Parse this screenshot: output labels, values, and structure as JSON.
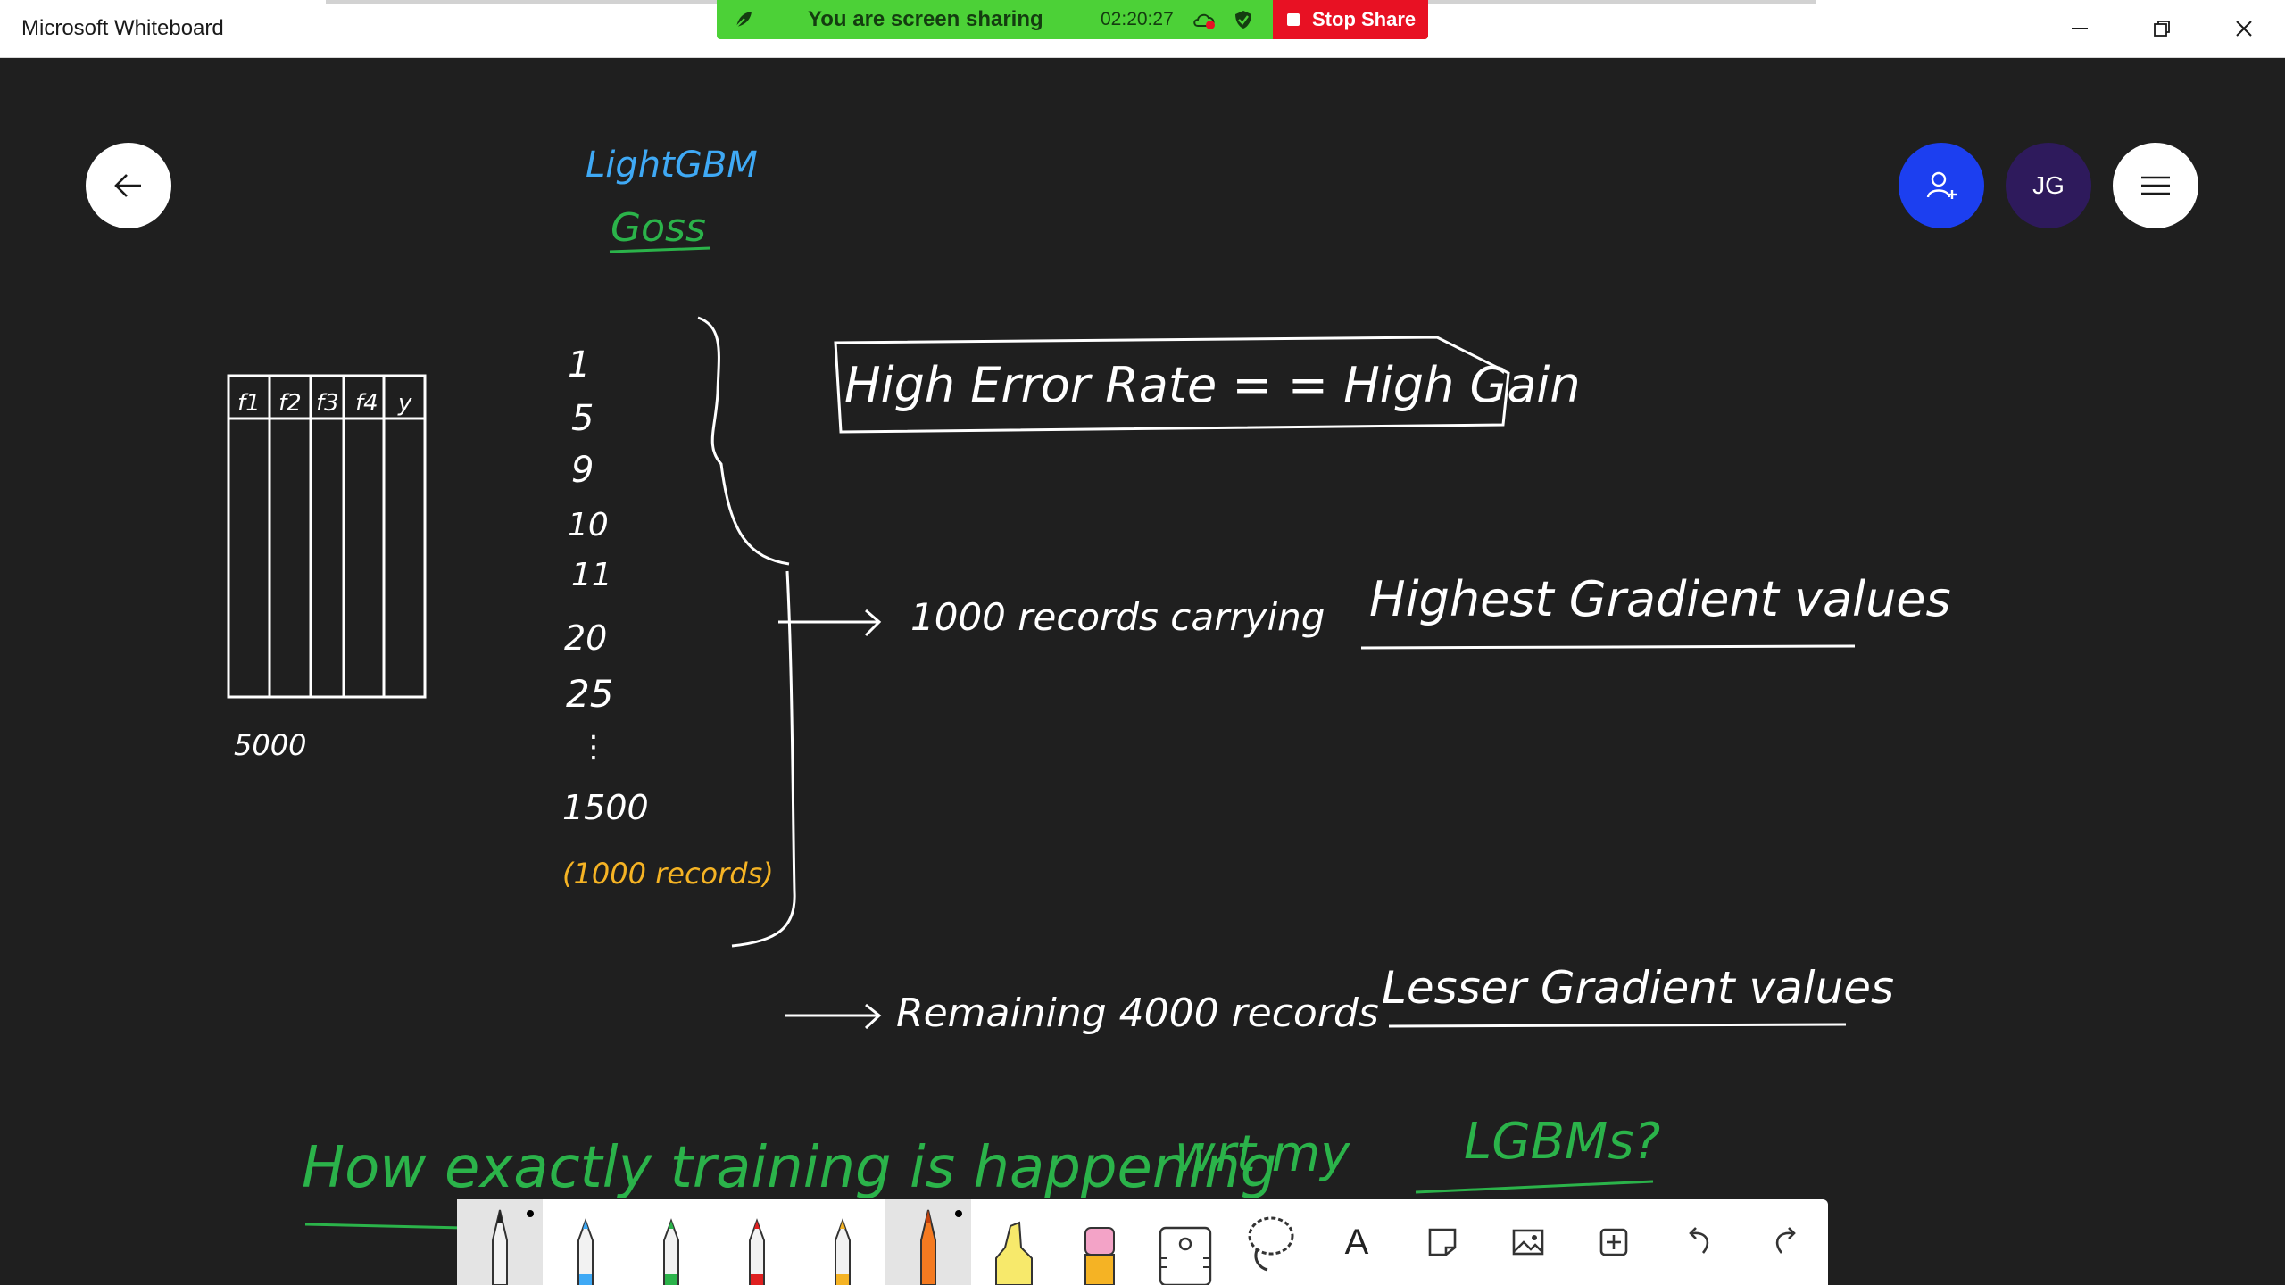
{
  "window": {
    "title": "Microsoft Whiteboard"
  },
  "share_bar": {
    "status": "You are screen sharing",
    "timer": "02:20:27",
    "stop_label": "Stop Share"
  },
  "header": {
    "avatar_initials": "JG"
  },
  "board": {
    "heading": "LightGBM",
    "subheading": "Goss",
    "table_columns": [
      "f1",
      "f2",
      "f3",
      "f4",
      "y"
    ],
    "table_count": "5000",
    "index_values": [
      "1",
      "5",
      "9",
      "10",
      "11",
      "20",
      "25",
      "⋮",
      "1500"
    ],
    "records_note": "(1000 records)",
    "box_text": "High Error Rate = = High Gain",
    "arrow1_text": "1000 records carrying",
    "arrow1_emph": "Highest Gradient values",
    "arrow2_text": "Remaining 4000 records",
    "arrow2_emph": "Lesser Gradient values",
    "question_a": "How exactly training is happening",
    "question_b": "wrt my",
    "question_c": "LGBMs?"
  },
  "colors": {
    "canvas": "#1f1f1f",
    "ink_white": "#ffffff",
    "ink_blue": "#3fa9f5",
    "ink_green": "#2bb34a",
    "ink_yellow": "#f5b324",
    "invite": "#1c3ff0",
    "avatar": "#2e1a5c",
    "share_green": "#4cd137",
    "stop_red": "#e81123"
  },
  "toolbar": {
    "tools": [
      {
        "name": "black-pen",
        "color": "#222222",
        "selected": true
      },
      {
        "name": "blue-pen",
        "color": "#3fa9f5",
        "selected": false
      },
      {
        "name": "green-pen",
        "color": "#2bb34a",
        "selected": false
      },
      {
        "name": "red-pen",
        "color": "#e02020",
        "selected": false
      },
      {
        "name": "yellow-pen",
        "color": "#f5b324",
        "selected": false
      },
      {
        "name": "orange-pen",
        "color": "#f47a20",
        "selected": true
      }
    ],
    "highlighter_color": "#f7e96b",
    "eraser_color": "#f3a3c7",
    "text_tool_label": "A"
  }
}
